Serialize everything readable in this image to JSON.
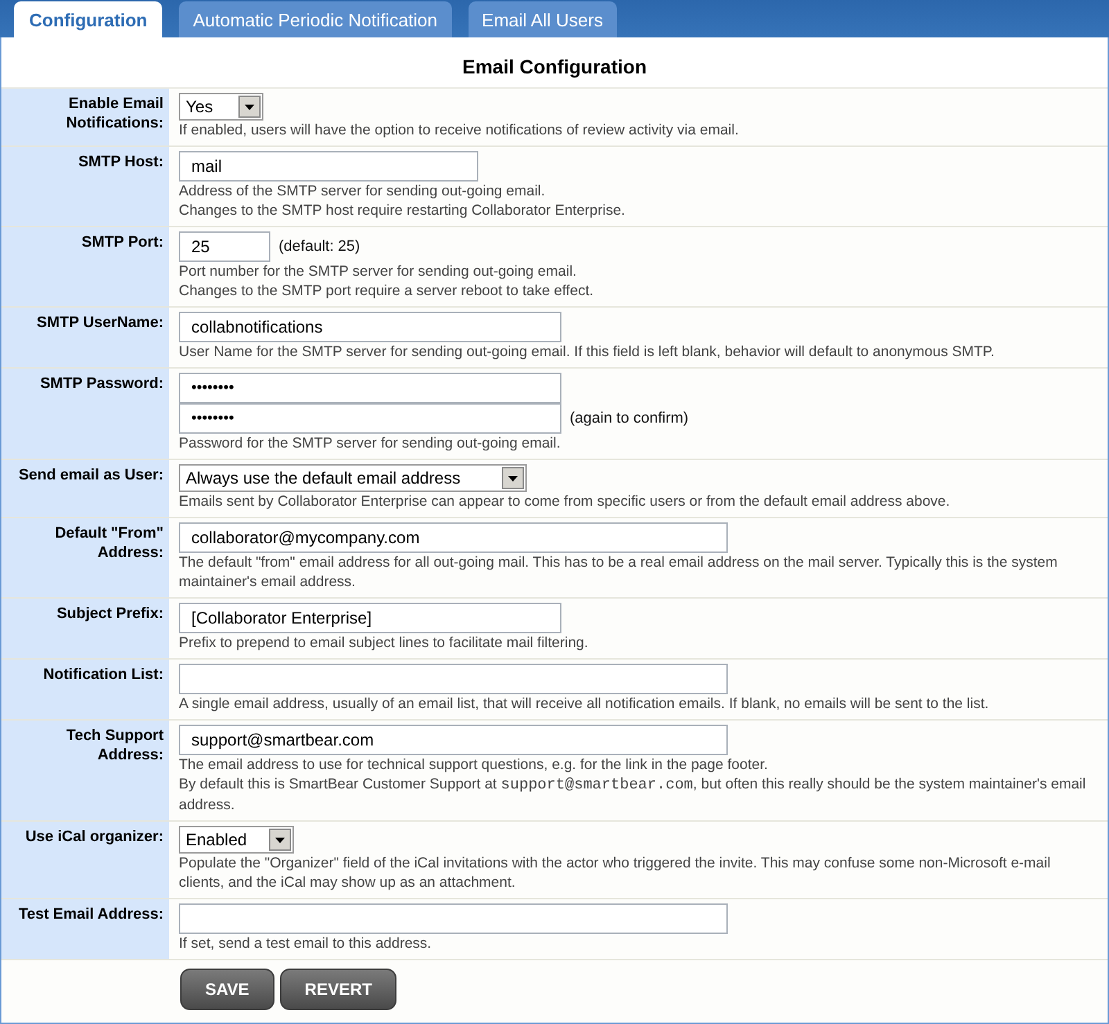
{
  "tabs": [
    {
      "label": "Configuration",
      "selected": true
    },
    {
      "label": "Automatic Periodic Notification",
      "selected": false
    },
    {
      "label": "Email All Users",
      "selected": false
    }
  ],
  "title": "Email Configuration",
  "settings": [
    {
      "label": "Enable Email Notifications:",
      "kind": "select",
      "value": "Yes",
      "help": [
        [
          {
            "kind": "plain",
            "text": "If enabled, users will have the option to receive notifications of review activity via email."
          }
        ]
      ]
    },
    {
      "label": "SMTP Host:",
      "kind": "text",
      "value": "mail",
      "help": [
        [
          {
            "kind": "plain",
            "text": "Address of the SMTP server for sending out-going email."
          }
        ],
        [
          {
            "kind": "plain",
            "text": "Changes to the SMTP host require restarting Collaborator Enterprise."
          }
        ]
      ]
    },
    {
      "label": "SMTP Port:",
      "kind": "text",
      "value": "25",
      "note": "(default: 25)",
      "help": [
        [
          {
            "kind": "plain",
            "text": "Port number for the SMTP server for sending out-going email."
          }
        ],
        [
          {
            "kind": "plain",
            "text": "Changes to the SMTP port require a server reboot to take effect."
          }
        ]
      ]
    },
    {
      "label": "SMTP UserName:",
      "kind": "text",
      "value": "collabnotifications",
      "help": [
        [
          {
            "kind": "plain",
            "text": "User Name for the SMTP server for sending out-going email. If this field is left blank, behavior will default to anonymous SMTP."
          }
        ]
      ]
    },
    {
      "label": "SMTP Password:",
      "kind": "password",
      "value": "••••••••",
      "confirm_value": "••••••••",
      "note": "(again to confirm)",
      "help": [
        [
          {
            "kind": "plain",
            "text": "Password for the SMTP server for sending out-going email."
          }
        ]
      ]
    },
    {
      "label": "Send email as User:",
      "kind": "select",
      "value": "Always use the default email address",
      "help": [
        [
          {
            "kind": "plain",
            "text": "Emails sent by Collaborator Enterprise can appear to come from specific users or from the default email address above."
          }
        ]
      ]
    },
    {
      "label": "Default \"From\" Address:",
      "kind": "text",
      "value": "collaborator@mycompany.com",
      "help": [
        [
          {
            "kind": "plain",
            "text": "The default \"from\" email address for all out-going mail. This has to be a real email address on the mail server. Typically this is the system maintainer's email address."
          }
        ]
      ]
    },
    {
      "label": "Subject Prefix:",
      "kind": "text",
      "value": "[Collaborator Enterprise]",
      "help": [
        [
          {
            "kind": "plain",
            "text": "Prefix to prepend to email subject lines to facilitate mail filtering."
          }
        ]
      ]
    },
    {
      "label": "Notification List:",
      "kind": "text",
      "help": [
        [
          {
            "kind": "plain",
            "text": "A single email address, usually of an email list, that will receive all notification emails. If blank, no emails will be sent to the list."
          }
        ]
      ]
    },
    {
      "label": "Tech Support Address:",
      "kind": "text",
      "value": "support@smartbear.com",
      "help": [
        [
          {
            "kind": "plain",
            "text": "The email address to use for technical support questions, e.g. for the link in the page footer."
          }
        ],
        [
          {
            "kind": "plain",
            "text": "By default this is SmartBear Customer Support at "
          },
          {
            "kind": "code",
            "text": "support@smartbear.com"
          },
          {
            "kind": "plain",
            "text": ", but often this really should be the system maintainer's email address."
          }
        ]
      ]
    },
    {
      "label": "Use iCal organizer:",
      "kind": "select",
      "value": "Enabled",
      "help": [
        [
          {
            "kind": "plain",
            "text": "Populate the \"Organizer\" field of the iCal invitations with the actor who triggered the invite. This may confuse some non-Microsoft e-mail clients, and the iCal may show up as an attachment."
          }
        ]
      ]
    },
    {
      "label": "Test Email Address:",
      "kind": "text",
      "help": [
        [
          {
            "kind": "plain",
            "text": "If set, send a test email to this address."
          }
        ]
      ]
    }
  ],
  "buttons": [
    "SAVE",
    "REVERT"
  ]
}
